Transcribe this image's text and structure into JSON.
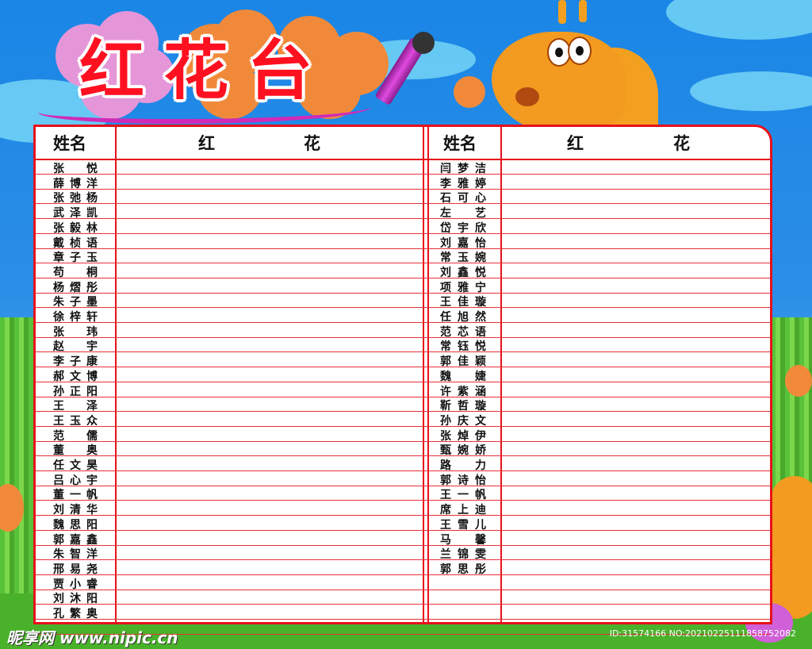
{
  "title": "红花台",
  "headers": {
    "left_name": "姓名",
    "left_flower_1": "红",
    "left_flower_2": "花",
    "right_name": "姓名",
    "right_flower_1": "红",
    "right_flower_2": "花"
  },
  "left_names": [
    "张　悦",
    "薛博洋",
    "张弛杨",
    "武泽凯",
    "张毅林",
    "戴桢语",
    "章子玉",
    "苟　桐",
    "杨熠彤",
    "朱子墨",
    "徐梓轩",
    "张　玮",
    "赵　宇",
    "李子康",
    "郝文博",
    "孙正阳",
    "王　泽",
    "王玉众",
    "范　儒",
    "董　奥",
    "任文昊",
    "吕心宇",
    "董一帆",
    "刘清华",
    "魏思阳",
    "郭嘉鑫",
    "朱智洋",
    "邢易尧",
    "贾小睿",
    "刘沐阳",
    "孔繁奥"
  ],
  "right_names": [
    "闫梦洁",
    "李雅婷",
    "石可心",
    "左　艺",
    "岱宇欣",
    "刘嘉怡",
    "常玉婉",
    "刘鑫悦",
    "项雅宁",
    "王佳璇",
    "任旭然",
    "范芯语",
    "常钰悦",
    "郭佳颖",
    "魏　婕",
    "许紫涵",
    "靳哲璇",
    "孙庆文",
    "张焯伊",
    "甄婉娇",
    "路　力",
    "郭诗怡",
    "王一帆",
    "席上迪",
    "王雪儿",
    "马　馨",
    "兰锦雯",
    "郭思彤"
  ],
  "watermark": "昵享网 www.nipic.cn",
  "image_id": "ID:31574166 NO:20210225111858752082",
  "colors": {
    "title_red": "#ff1020",
    "grid_red": "#e8101a",
    "sky": "#1a86e6",
    "grass": "#5cc63a"
  }
}
